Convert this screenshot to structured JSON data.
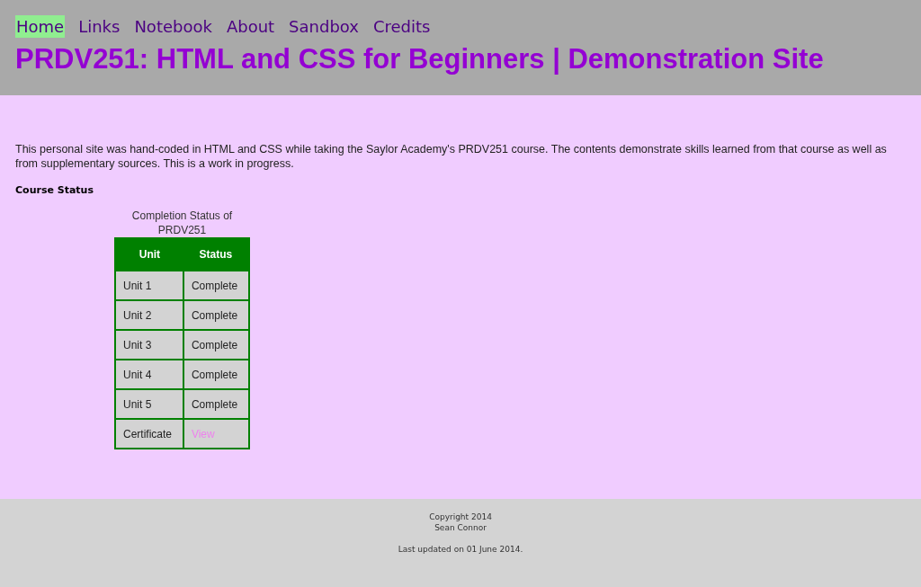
{
  "nav": [
    {
      "label": "Home",
      "selected": true
    },
    {
      "label": "Links",
      "selected": false
    },
    {
      "label": "Notebook",
      "selected": false
    },
    {
      "label": "About",
      "selected": false
    },
    {
      "label": "Sandbox",
      "selected": false
    },
    {
      "label": "Credits",
      "selected": false
    }
  ],
  "site_title": "PRDV251: HTML and CSS for Beginners | Demonstration Site",
  "intro": "This personal site was hand-coded in HTML and CSS while taking the Saylor Academy's PRDV251 course. The contents demonstrate skills learned from that course as well as from supplementary sources. This is a work in progress.",
  "section_heading": "Course Status",
  "table": {
    "caption": "Completion Status of PRDV251",
    "columns": [
      "Unit",
      "Status"
    ],
    "rows": [
      {
        "unit": "Unit 1",
        "status": "Complete",
        "kind": "text"
      },
      {
        "unit": "Unit 2",
        "status": "Complete",
        "kind": "text"
      },
      {
        "unit": "Unit 3",
        "status": "Complete",
        "kind": "text"
      },
      {
        "unit": "Unit 4",
        "status": "Complete",
        "kind": "text"
      },
      {
        "unit": "Unit 5",
        "status": "Complete",
        "kind": "text"
      },
      {
        "unit": "Certificate",
        "status": "View",
        "kind": "link"
      }
    ]
  },
  "footer": {
    "copyright": "Copyright 2014",
    "author": "Sean Connor",
    "updated": "Last updated on 01 June 2014."
  }
}
